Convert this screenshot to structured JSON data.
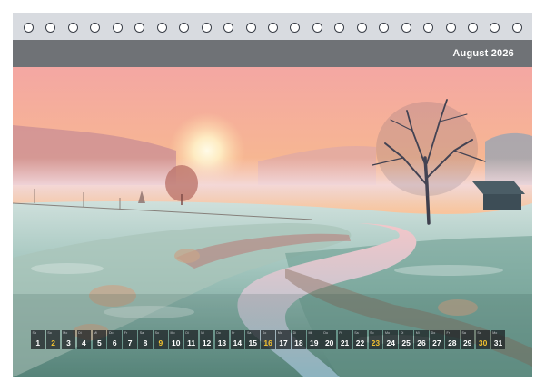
{
  "header": {
    "month_label": "August 2026"
  },
  "calendar": {
    "days": [
      {
        "dow": "Sa",
        "n": "1",
        "hl": false
      },
      {
        "dow": "So",
        "n": "2",
        "hl": true
      },
      {
        "dow": "Mo",
        "n": "3",
        "hl": false
      },
      {
        "dow": "Di",
        "n": "4",
        "hl": false
      },
      {
        "dow": "Mi",
        "n": "5",
        "hl": false
      },
      {
        "dow": "Do",
        "n": "6",
        "hl": false
      },
      {
        "dow": "Fr",
        "n": "7",
        "hl": false
      },
      {
        "dow": "Sa",
        "n": "8",
        "hl": false
      },
      {
        "dow": "So",
        "n": "9",
        "hl": true
      },
      {
        "dow": "Mo",
        "n": "10",
        "hl": false
      },
      {
        "dow": "Di",
        "n": "11",
        "hl": false
      },
      {
        "dow": "Mi",
        "n": "12",
        "hl": false
      },
      {
        "dow": "Do",
        "n": "13",
        "hl": false
      },
      {
        "dow": "Fr",
        "n": "14",
        "hl": false
      },
      {
        "dow": "Sa",
        "n": "15",
        "hl": false
      },
      {
        "dow": "So",
        "n": "16",
        "hl": true
      },
      {
        "dow": "Mo",
        "n": "17",
        "hl": false
      },
      {
        "dow": "Di",
        "n": "18",
        "hl": false
      },
      {
        "dow": "Mi",
        "n": "19",
        "hl": false
      },
      {
        "dow": "Do",
        "n": "20",
        "hl": false
      },
      {
        "dow": "Fr",
        "n": "21",
        "hl": false
      },
      {
        "dow": "Sa",
        "n": "22",
        "hl": false
      },
      {
        "dow": "So",
        "n": "23",
        "hl": true
      },
      {
        "dow": "Mo",
        "n": "24",
        "hl": false
      },
      {
        "dow": "Di",
        "n": "25",
        "hl": false
      },
      {
        "dow": "Mi",
        "n": "26",
        "hl": false
      },
      {
        "dow": "Do",
        "n": "27",
        "hl": false
      },
      {
        "dow": "Fr",
        "n": "28",
        "hl": false
      },
      {
        "dow": "Sa",
        "n": "29",
        "hl": false
      },
      {
        "dow": "So",
        "n": "30",
        "hl": true
      },
      {
        "dow": "Mo",
        "n": "31",
        "hl": false
      }
    ]
  },
  "colors": {
    "header_bar": "#6f7276",
    "highlight": "#f2c230",
    "day_cell": "#1c1f23"
  }
}
